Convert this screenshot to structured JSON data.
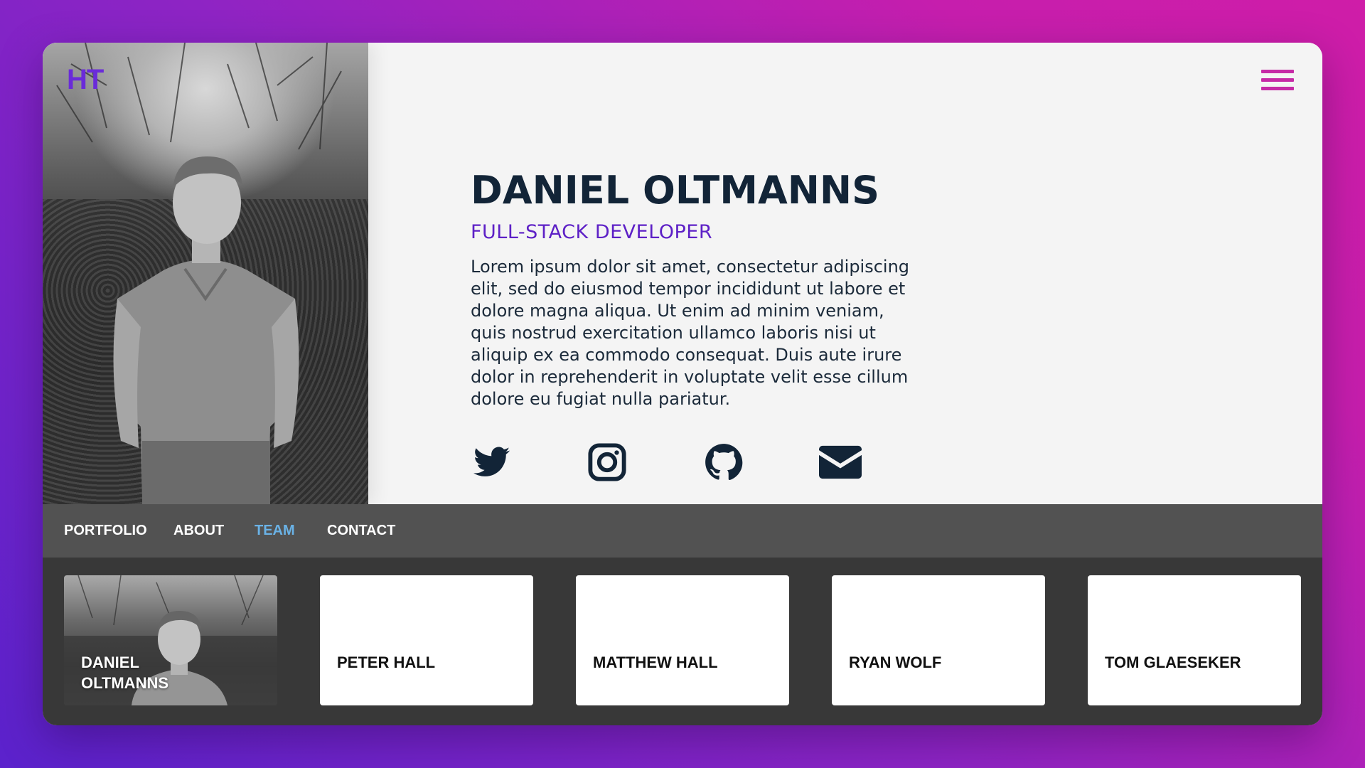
{
  "brand": {
    "logo": "HT",
    "accent_color": "#5d20c6",
    "menu_color": "#c62aa6"
  },
  "profile": {
    "name": "DANIEL OLTMANNS",
    "role": "FULL-STACK DEVELOPER",
    "bio": "Lorem ipsum dolor sit amet, consectetur adipiscing elit, sed do eiusmod tempor incididunt ut labore et dolore magna aliqua. Ut enim ad minim veniam, quis nostrud exercitation ullamco laboris nisi ut aliquip ex ea commodo consequat. Duis aute irure dolor in reprehenderit in voluptate velit esse cillum dolore eu fugiat nulla pariatur.",
    "photo": "portrait-photo"
  },
  "socials": [
    {
      "icon": "twitter-icon"
    },
    {
      "icon": "instagram-icon"
    },
    {
      "icon": "github-icon"
    },
    {
      "icon": "mail-icon"
    }
  ],
  "nav": {
    "items": [
      {
        "label": "PORTFOLIO",
        "active": false
      },
      {
        "label": "ABOUT",
        "active": false
      },
      {
        "label": "TEAM",
        "active": true
      },
      {
        "label": "CONTACT",
        "active": false
      }
    ],
    "active_color": "#6ab2e6"
  },
  "team": {
    "members": [
      {
        "name": "DANIEL OLTMANNS",
        "has_photo": true
      },
      {
        "name": "PETER HALL",
        "has_photo": false
      },
      {
        "name": "MATTHEW HALL",
        "has_photo": false
      },
      {
        "name": "RYAN WOLF",
        "has_photo": false
      },
      {
        "name": "TOM GLAESEKER",
        "has_photo": false
      }
    ]
  }
}
